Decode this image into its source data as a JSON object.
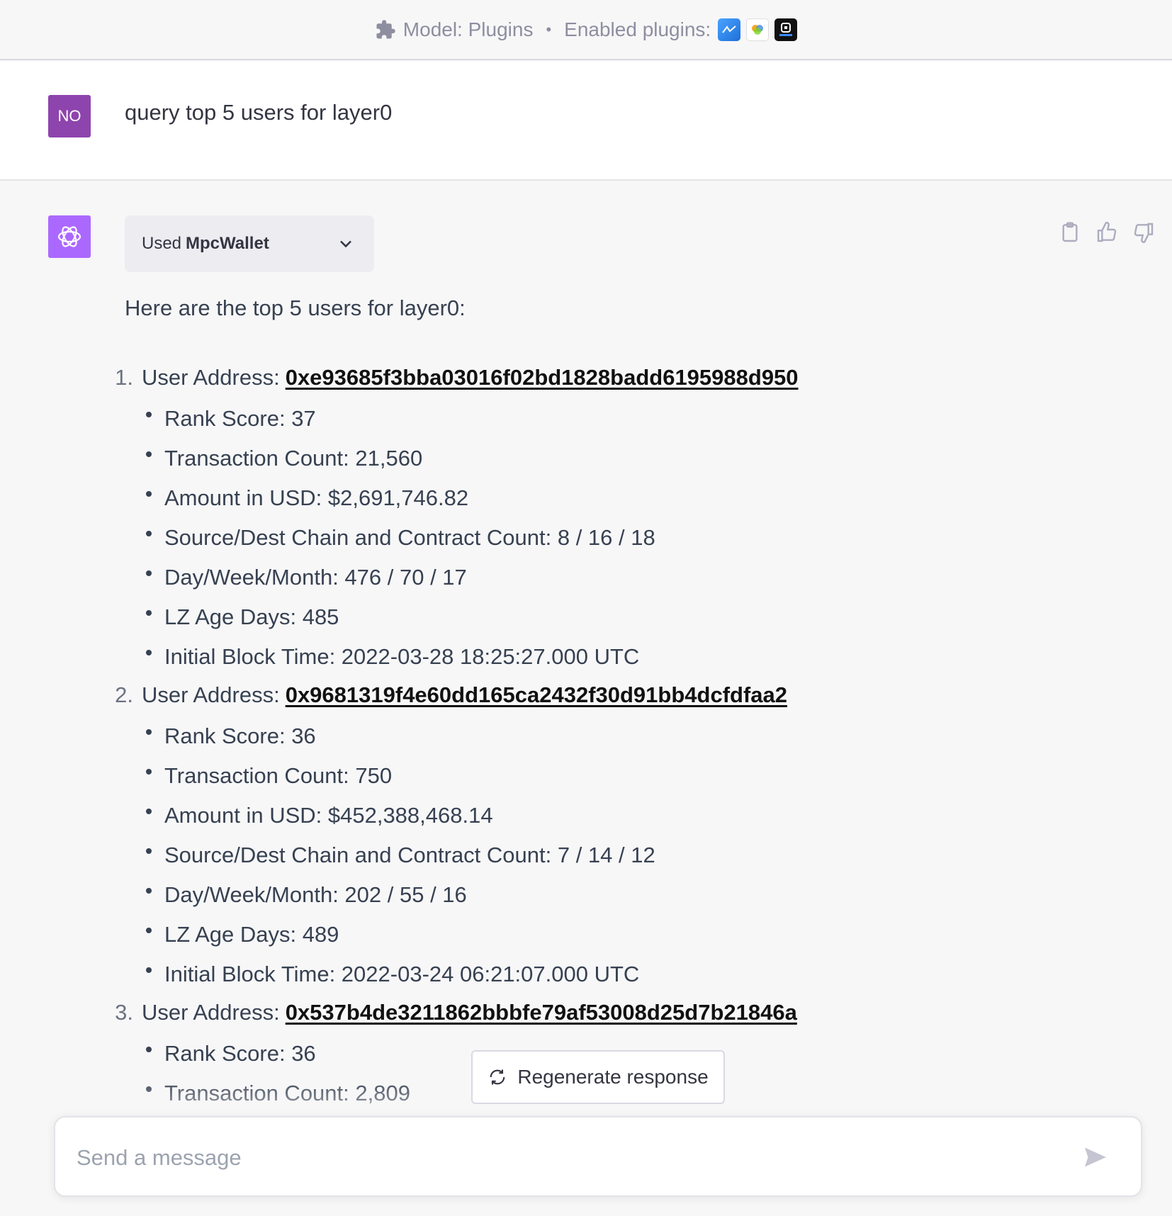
{
  "topbar": {
    "model_label": "Model: Plugins",
    "separator": "•",
    "plugins_label": "Enabled plugins:",
    "plugin_icons": [
      "askyourpdf-icon",
      "mpcwallet-icon",
      "metapath-icon"
    ]
  },
  "user_message": {
    "avatar_initials": "NO",
    "text": "query top 5 users for layer0"
  },
  "assistant": {
    "plugin_used_prefix": "Used",
    "plugin_used_name": "MpcWallet",
    "intro": "Here are the top 5 users for layer0:",
    "entries": [
      {
        "num": "1.",
        "label": "User Address:",
        "address": "0xe93685f3bba03016f02bd1828badd6195988d950",
        "details": [
          "Rank Score: 37",
          "Transaction Count: 21,560",
          "Amount in USD: $2,691,746.82",
          "Source/Dest Chain and Contract Count: 8 / 16 / 18",
          "Day/Week/Month: 476 / 70 / 17",
          "LZ Age Days: 485",
          "Initial Block Time: 2022-03-28 18:25:27.000 UTC"
        ]
      },
      {
        "num": "2.",
        "label": "User Address:",
        "address": "0x9681319f4e60dd165ca2432f30d91bb4dcfdfaa2",
        "details": [
          "Rank Score: 36",
          "Transaction Count: 750",
          "Amount in USD: $452,388,468.14",
          "Source/Dest Chain and Contract Count: 7 / 14 / 12",
          "Day/Week/Month: 202 / 55 / 16",
          "LZ Age Days: 489",
          "Initial Block Time: 2022-03-24 06:21:07.000 UTC"
        ]
      },
      {
        "num": "3.",
        "label": "User Address:",
        "address": "0x537b4de3211862bbbfe79af53008d25d7b21846a",
        "details": [
          "Rank Score: 36",
          "Transaction Count: 2,809"
        ]
      }
    ]
  },
  "regenerate_label": "Regenerate response",
  "composer": {
    "placeholder": "Send a message"
  },
  "colors": {
    "user_avatar": "#8e44ad",
    "bot_avatar": "#ab68ff",
    "background": "#f7f7f8"
  }
}
